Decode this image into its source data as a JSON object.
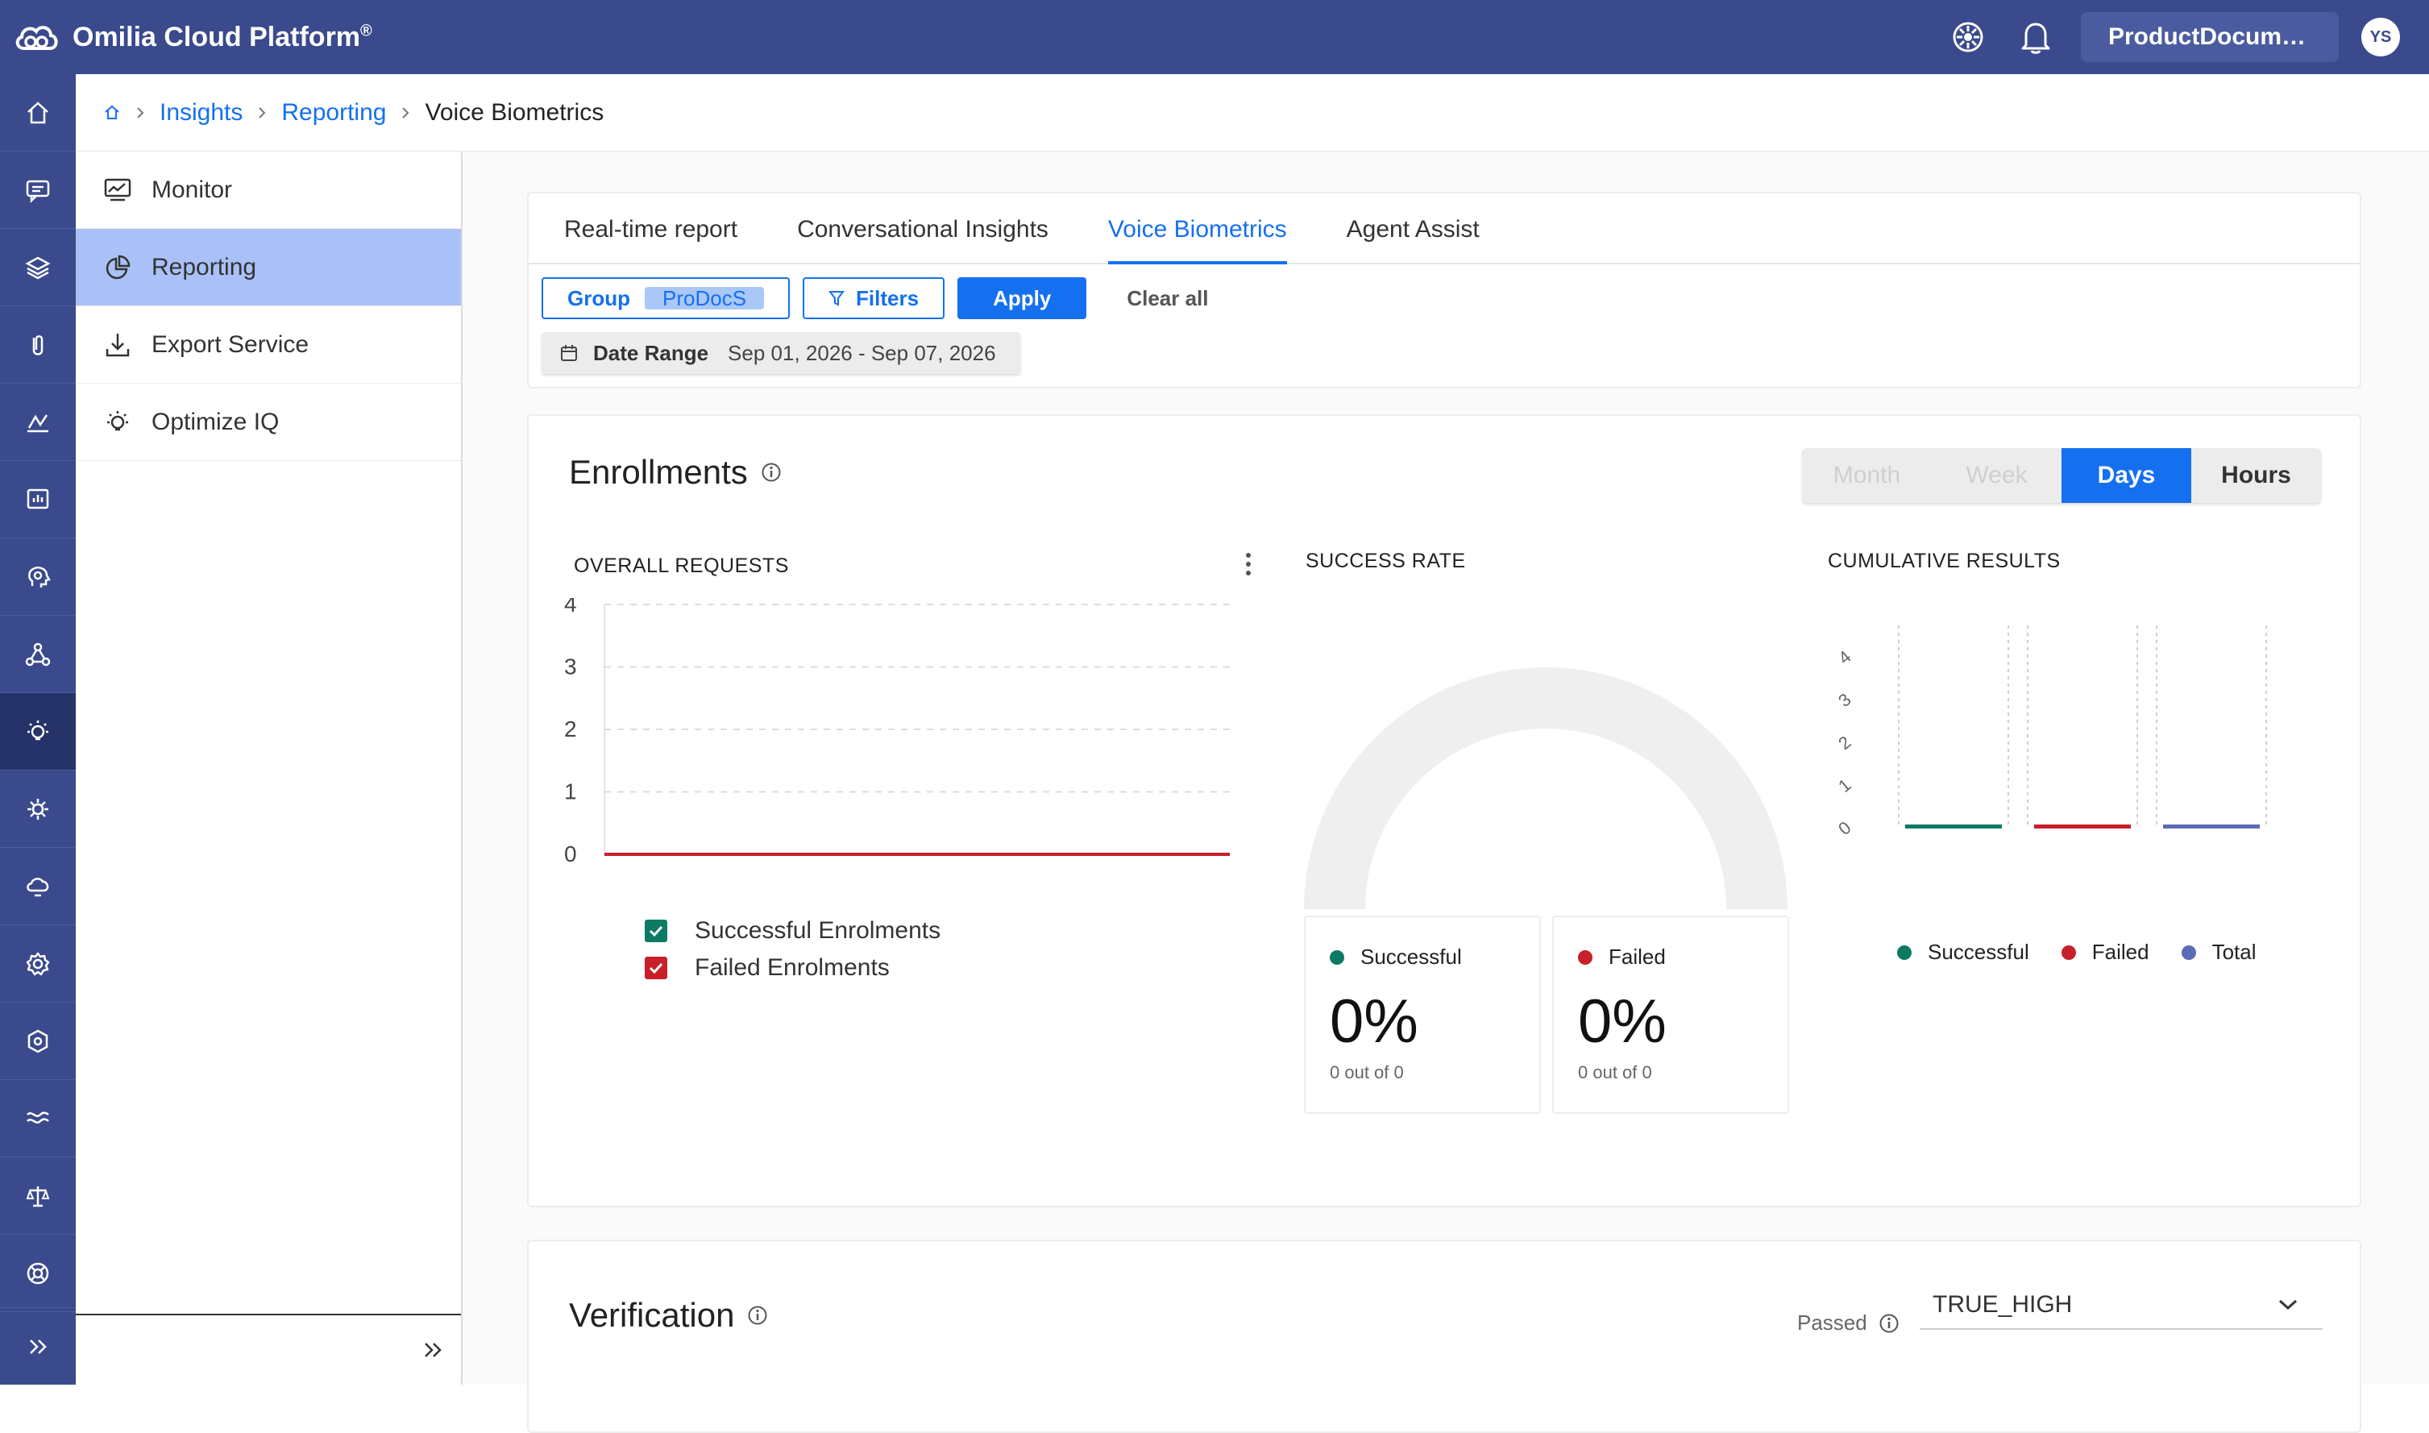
{
  "app": {
    "brand_name": "Omilia Cloud Platform",
    "brand_mark": "®",
    "workspace": "ProductDocume...",
    "avatar_initials": "YS"
  },
  "breadcrumb": {
    "items": [
      "Insights",
      "Reporting"
    ],
    "current": "Voice Biometrics"
  },
  "sidemenu": {
    "items": [
      {
        "label": "Monitor",
        "icon": "monitor-icon"
      },
      {
        "label": "Reporting",
        "icon": "pie-chart-icon"
      },
      {
        "label": "Export Service",
        "icon": "download-icon"
      },
      {
        "label": "Optimize IQ",
        "icon": "lightbulb-icon"
      }
    ],
    "active": "Reporting"
  },
  "tabs": {
    "items": [
      "Real-time report",
      "Conversational Insights",
      "Voice Biometrics",
      "Agent Assist"
    ],
    "active": "Voice Biometrics"
  },
  "filters": {
    "group_label": "Group",
    "group_value": "ProDocS",
    "filters_label": "Filters",
    "apply_label": "Apply",
    "clear_label": "Clear all",
    "date_range_label": "Date Range",
    "date_range_value": "Sep 01, 2026 - Sep 07, 2026"
  },
  "enrollments": {
    "title": "Enrollments",
    "granularity": {
      "options": [
        "Month",
        "Week",
        "Days",
        "Hours"
      ],
      "selected": "Days",
      "disabled": [
        "Month",
        "Week"
      ]
    },
    "overall_requests": {
      "label": "OVERALL REQUESTS",
      "legend": [
        "Successful Enrolments",
        "Failed Enrolments"
      ]
    },
    "success_rate": {
      "label": "SUCCESS RATE",
      "successful": {
        "label": "Successful",
        "value": "0%",
        "sub": "0 out of 0"
      },
      "failed": {
        "label": "Failed",
        "value": "0%",
        "sub": "0 out of 0"
      }
    },
    "cumulative": {
      "label": "CUMULATIVE RESULTS",
      "legend": [
        "Successful",
        "Failed",
        "Total"
      ]
    }
  },
  "verification": {
    "title": "Verification",
    "passed_label": "Passed",
    "passed_value": "TRUE_HIGH"
  },
  "colors": {
    "header": "#3a4a8c",
    "accent": "#1570ef",
    "successful": "#0f7a63",
    "failed": "#c8202a",
    "total": "#5b6bb5"
  },
  "chart_data": [
    {
      "type": "line",
      "title": "OVERALL REQUESTS",
      "y_ticks": [
        0,
        1,
        2,
        3,
        4
      ],
      "ylim": [
        0,
        4
      ],
      "series": [
        {
          "name": "Successful Enrolments",
          "values": [
            0,
            0,
            0,
            0,
            0,
            0,
            0
          ]
        },
        {
          "name": "Failed Enrolments",
          "values": [
            0,
            0,
            0,
            0,
            0,
            0,
            0
          ]
        }
      ],
      "grid": true
    },
    {
      "type": "pie",
      "title": "SUCCESS RATE",
      "series": [
        {
          "name": "Successful",
          "values": [
            0
          ]
        },
        {
          "name": "Failed",
          "values": [
            0
          ]
        }
      ]
    },
    {
      "type": "bar",
      "title": "CUMULATIVE RESULTS",
      "y_ticks": [
        0,
        1,
        2,
        3,
        4
      ],
      "categories": [
        "Successful",
        "Failed",
        "Total"
      ],
      "values": [
        0,
        0,
        0
      ]
    }
  ]
}
